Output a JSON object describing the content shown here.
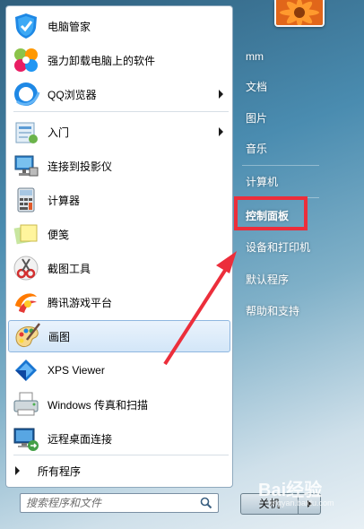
{
  "programs": [
    {
      "label": "电脑管家",
      "icon": "shield-icon"
    },
    {
      "label": "强力卸载电脑上的软件",
      "icon": "clover-icon"
    },
    {
      "label": "QQ浏览器",
      "icon": "qq-browser-icon",
      "submenu": true
    },
    {
      "label": "入门",
      "icon": "getting-started-icon",
      "submenu": true
    },
    {
      "label": "连接到投影仪",
      "icon": "projector-icon"
    },
    {
      "label": "计算器",
      "icon": "calculator-icon"
    },
    {
      "label": "便笺",
      "icon": "sticky-notes-icon"
    },
    {
      "label": "截图工具",
      "icon": "snipping-tool-icon"
    },
    {
      "label": "腾讯游戏平台",
      "icon": "tencent-games-icon"
    },
    {
      "label": "画图",
      "icon": "paint-icon",
      "selected": true
    },
    {
      "label": "XPS Viewer",
      "icon": "xps-viewer-icon"
    },
    {
      "label": "Windows 传真和扫描",
      "icon": "fax-scan-icon"
    },
    {
      "label": "远程桌面连接",
      "icon": "remote-desktop-icon"
    }
  ],
  "all_programs": "所有程序",
  "search": {
    "placeholder": "搜索程序和文件"
  },
  "right": {
    "user": "mm",
    "documents": "文档",
    "pictures": "图片",
    "music": "音乐",
    "computer": "计算机",
    "control_panel": "控制面板",
    "devices_printers": "设备和打印机",
    "default_programs": "默认程序",
    "help_support": "帮助和支持"
  },
  "shutdown": {
    "label": "关机"
  },
  "watermark": {
    "text": "Bai经验",
    "url": "jingyan.baidu.com"
  },
  "colors": {
    "highlight_box": "#ec2e3b",
    "arrow": "#ec2e3b",
    "selection": "#d3e6f8"
  }
}
